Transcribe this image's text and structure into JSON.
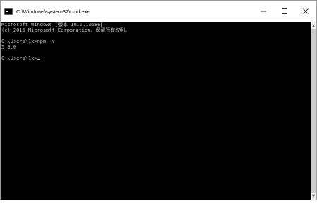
{
  "window": {
    "title": "C:\\Windows\\system32\\cmd.exe"
  },
  "controls": {
    "minimize_icon": "minimize-icon",
    "maximize_icon": "maximize-icon",
    "close_icon": "close-icon"
  },
  "console": {
    "lines": [
      "Microsoft Windows [版本 10.0.10586]",
      "(c) 2015 Microsoft Corporation。保留所有权利。",
      "",
      "C:\\Users\\1x>npm -v",
      "5.3.0",
      "",
      "C:\\Users\\1x>"
    ],
    "text_color": "#c0c0c0",
    "background_color": "#000000"
  }
}
